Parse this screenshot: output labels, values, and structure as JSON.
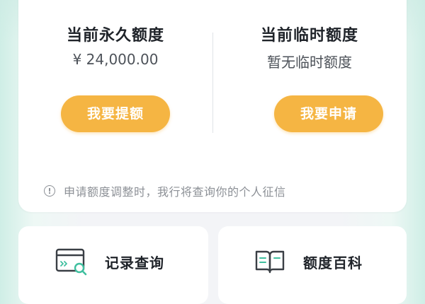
{
  "permanent_quota": {
    "title": "当前永久额度",
    "value": "¥ 24,000.00",
    "button_label": "我要提额"
  },
  "temporary_quota": {
    "title": "当前临时额度",
    "value": "暂无临时额度",
    "button_label": "我要申请"
  },
  "notice": {
    "icon": "info-circle-icon",
    "text": "申请额度调整时，我行将查询你的个人征信"
  },
  "tiles": [
    {
      "label": "记录查询",
      "icon": "record-search-icon"
    },
    {
      "label": "额度百科",
      "icon": "open-book-icon"
    }
  ],
  "colors": {
    "accent": "#f5b543",
    "icon_green": "#3fbf9f",
    "text_primary": "#1f2329",
    "text_secondary": "#8c9096"
  }
}
